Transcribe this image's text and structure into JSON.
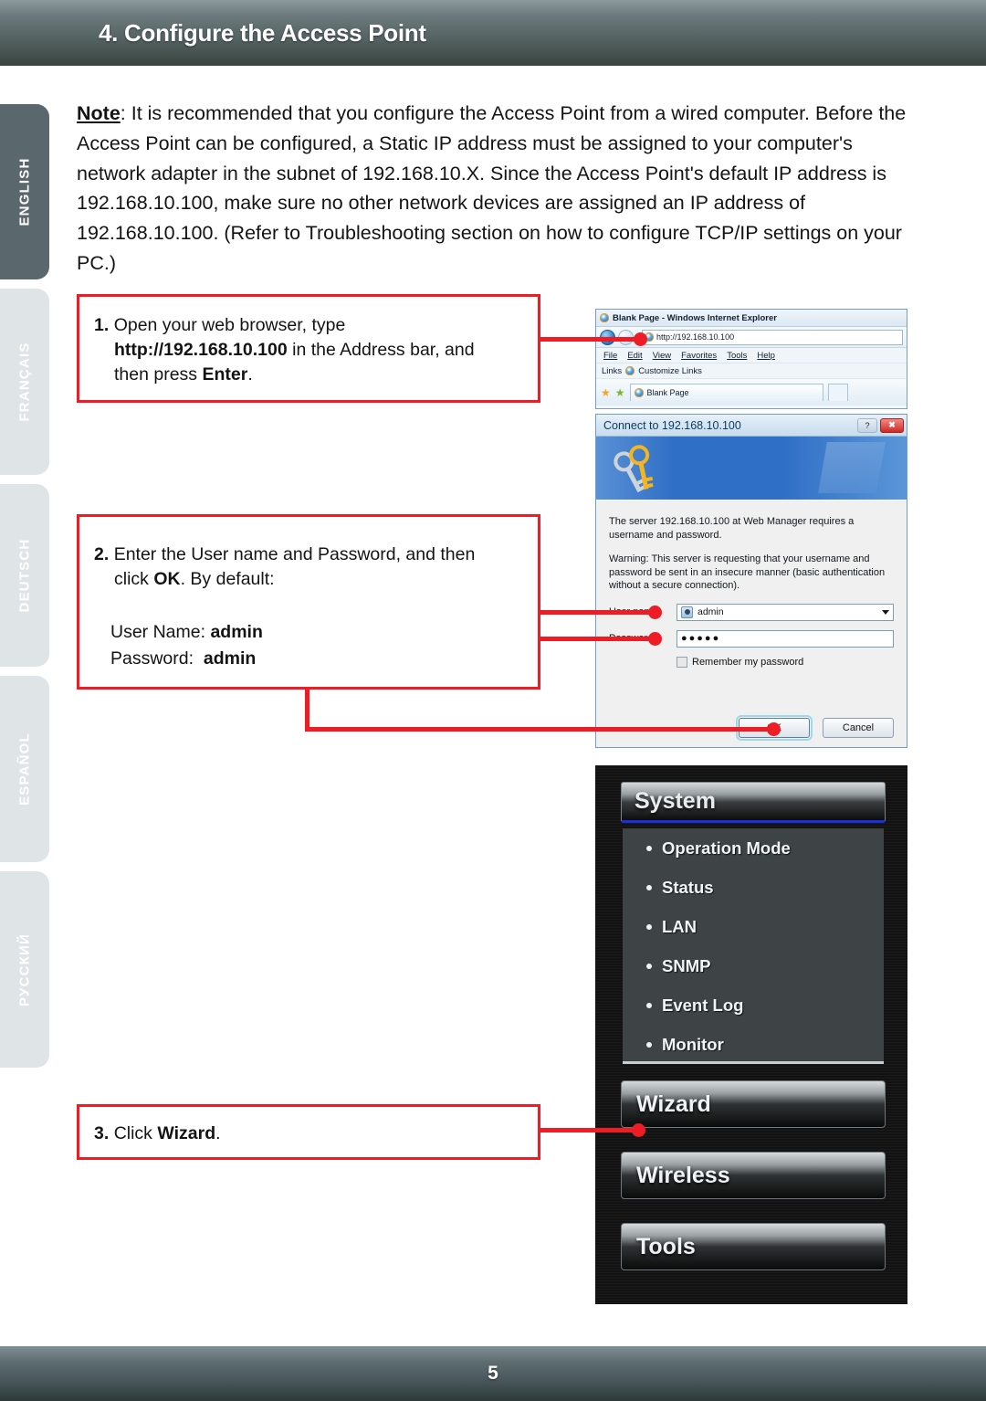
{
  "header": {
    "title": "4. Configure the Access Point"
  },
  "sidebar": {
    "items": [
      {
        "label": "ENGLISH",
        "active": true
      },
      {
        "label": "FRANÇAIS",
        "active": false
      },
      {
        "label": "DEUTSCH",
        "active": false
      },
      {
        "label": "ESPAÑOL",
        "active": false
      },
      {
        "label": "РУССКИЙ",
        "active": false
      }
    ]
  },
  "note": {
    "label": "Note",
    "text": ": It is recommended that you configure the Access Point from a wired computer. Before the Access Point can be configured, a Static IP address must be assigned to your computer's network adapter in the subnet of 192.168.10.X.  Since the Access Point's default IP address is 192.168.10.100, make sure no other network devices are assigned an IP address of 192.168.10.100.  (Refer to Troubleshooting section on how to configure TCP/IP settings on your PC.)"
  },
  "steps": [
    {
      "number": "1.",
      "line1": "Open your web browser, type",
      "url": "http://192.168.10.100",
      "line2_rest": " in the Address bar, and",
      "line3_pre": "then press ",
      "line3_bold": "Enter",
      "line3_post": "."
    },
    {
      "number": "2.",
      "line1": "Enter the User name and Password, and then",
      "line2_pre": "click ",
      "line2_bold": "OK",
      "line2_post": ". By default:",
      "cred_user_label": "User Name:",
      "cred_user_value": "admin",
      "cred_pass_label": "Password:",
      "cred_pass_value": "admin"
    },
    {
      "number": "3.",
      "line1_pre": "Click ",
      "line1_bold": "Wizard",
      "line1_post": "."
    }
  ],
  "browser": {
    "title": "Blank Page - Windows Internet Explorer",
    "address": "http://192.168.10.100",
    "menu": [
      "File",
      "Edit",
      "View",
      "Favorites",
      "Tools",
      "Help"
    ],
    "links_label": "Links",
    "links_item": "Customize Links",
    "tab_label": "Blank Page"
  },
  "dialog": {
    "title": "Connect to 192.168.10.100",
    "help_glyph": "?",
    "close_glyph": "✖",
    "message": "The server 192.168.10.100 at Web Manager requires a username and password.",
    "warning": "Warning: This server is requesting that your username and password be sent in an insecure manner (basic authentication without a secure connection).",
    "user_label": "User name:",
    "user_label_underline": "U",
    "user_value": "admin",
    "password_label": "Password:",
    "password_label_underline": "P",
    "password_value": "●●●●●",
    "remember_label": "Remember my password",
    "remember_underline": "R",
    "ok_label": "OK",
    "cancel_label": "Cancel"
  },
  "device_menu": {
    "section_title": "System",
    "items": [
      "Operation Mode",
      "Status",
      "LAN",
      "SNMP",
      "Event Log",
      "Monitor"
    ],
    "buttons": [
      "Wizard",
      "Wireless",
      "Tools"
    ]
  },
  "footer": {
    "page_number": "5"
  },
  "colors": {
    "accent_red": "#ee1c25",
    "header_dark": "#39443f",
    "tab_active": "#5a676c",
    "tab_inactive": "#dfe4e6",
    "menu_blue_underline": "#1c2fe0"
  }
}
